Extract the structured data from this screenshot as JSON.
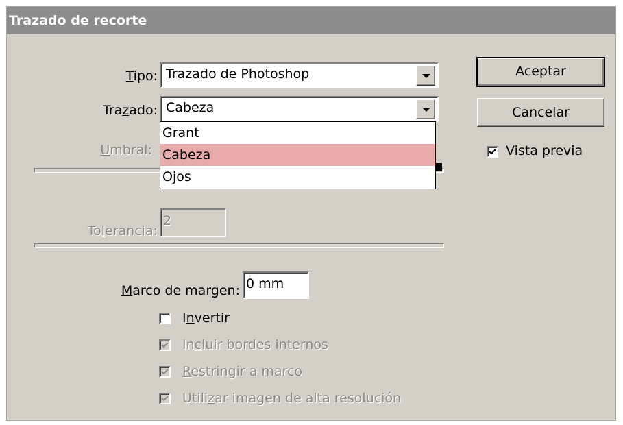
{
  "dialog": {
    "title": "Trazado de recorte"
  },
  "tipo": {
    "label_pre": "",
    "label_u": "T",
    "label_post": "ipo:",
    "value": "Trazado de Photoshop"
  },
  "trazado": {
    "label_pre": "Tra",
    "label_u": "z",
    "label_post": "ado:",
    "value": "Cabeza",
    "options": [
      "Grant",
      "Cabeza",
      "Ojos"
    ]
  },
  "umbral": {
    "label_pre": "",
    "label_u": "U",
    "label_post": "mbral:"
  },
  "tolerancia": {
    "label_pre": "To",
    "label_u": "l",
    "label_post": "erancia:",
    "value": "2"
  },
  "marco": {
    "label_pre": "",
    "label_u": "M",
    "label_post": "arco de margen:",
    "value": "0 mm"
  },
  "checks": {
    "invertir": {
      "pre": "I",
      "u": "n",
      "post": "vertir",
      "checked": false
    },
    "incluir": {
      "pre": "In",
      "u": "c",
      "post": "luir bordes internos",
      "checked": true
    },
    "restringir": {
      "pre": "",
      "u": "R",
      "post": "estringir a marco",
      "checked": true
    },
    "utilizar": {
      "pre": "Utili",
      "u": "z",
      "post": "ar imagen de alta resolución",
      "checked": true
    }
  },
  "buttons": {
    "ok": "Aceptar",
    "cancel": "Cancelar"
  },
  "preview": {
    "pre": "Vista ",
    "u": "p",
    "post": "revia",
    "checked": true
  }
}
